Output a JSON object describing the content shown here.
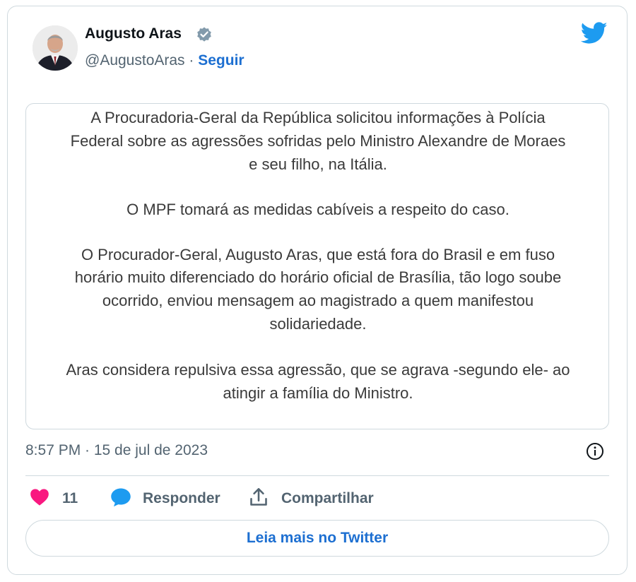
{
  "author": {
    "name": "Augusto Aras",
    "handle": "@AugustoAras",
    "separator": "·",
    "follow_label": "Seguir",
    "verified": true
  },
  "quote": {
    "paragraphs": [
      [
        "A Procuradoria-Geral da República solicitou informações à Polícia",
        "Federal sobre as agressões sofridas pelo Ministro Alexandre de Moraes",
        "e seu filho, na Itália."
      ],
      [
        "O MPF tomará as medidas cabíveis a respeito do caso."
      ],
      [
        "O Procurador-Geral, Augusto Aras, que está fora do Brasil e em fuso",
        "horário muito diferenciado do horário oficial de Brasília, tão logo soube",
        "ocorrido, enviou mensagem ao magistrado a quem manifestou",
        "solidariedade."
      ],
      [
        "Aras considera repulsiva essa agressão, que se agrava -segundo ele- ao",
        "atingir a família do Ministro."
      ]
    ]
  },
  "timestamp": "8:57 PM · 15 de jul de 2023",
  "actions": {
    "like_count": "11",
    "reply_label": "Responder",
    "share_label": "Compartilhar"
  },
  "read_more_label": "Leia mais no Twitter",
  "colors": {
    "twitter_blue": "#1d9bf0",
    "link_blue": "#1d6fd1",
    "like_pink": "#f91880",
    "muted_text": "#536471",
    "border": "#cfd9de"
  },
  "icons": [
    "verified-badge-icon",
    "twitter-bird-icon",
    "info-icon",
    "heart-icon",
    "reply-bubble-icon",
    "share-icon"
  ]
}
